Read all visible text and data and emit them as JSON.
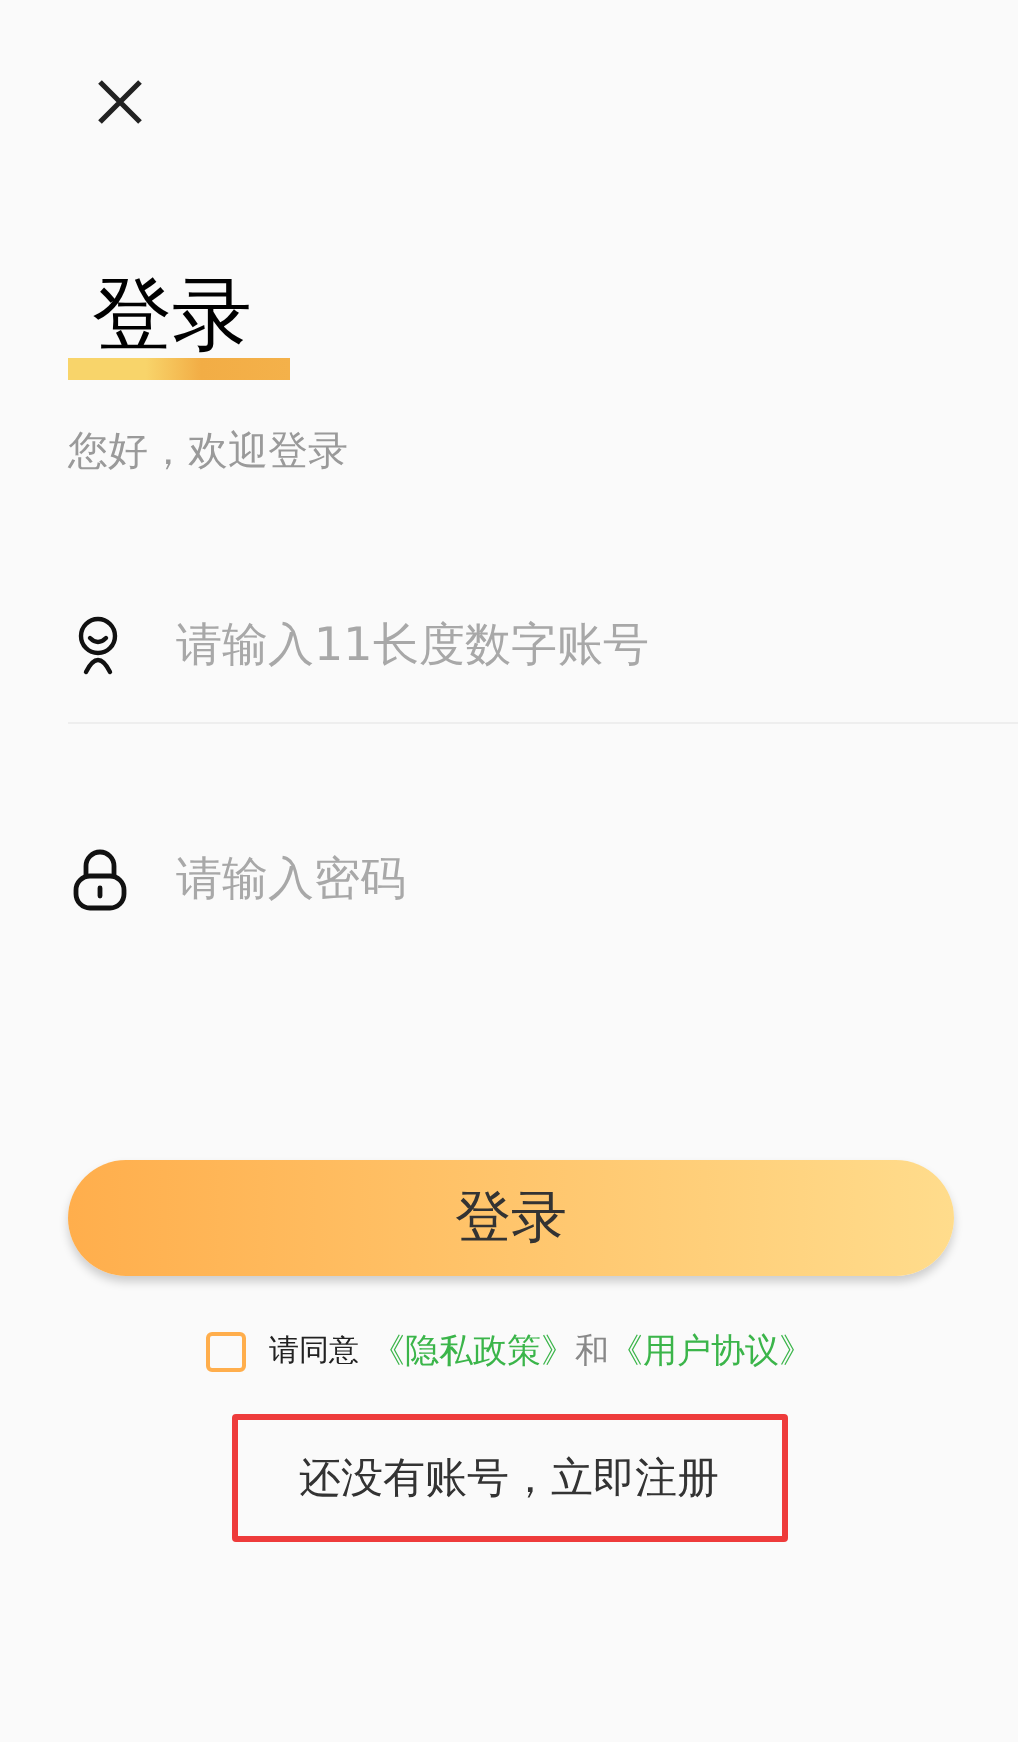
{
  "title": "登录",
  "subtitle": "您好，欢迎登录",
  "fields": [
    {
      "kind": "account",
      "placeholder": "请输入11长度数字账号"
    },
    {
      "kind": "password",
      "placeholder": "请输入密码"
    }
  ],
  "login_button": "登录",
  "agreement": {
    "checked": false,
    "prefix": "请同意",
    "links": [
      "《隐私政策》",
      "《用户协议》"
    ],
    "joiner": "和"
  },
  "register": {
    "text": "还没有账号，立即注册",
    "highlighted": true
  }
}
